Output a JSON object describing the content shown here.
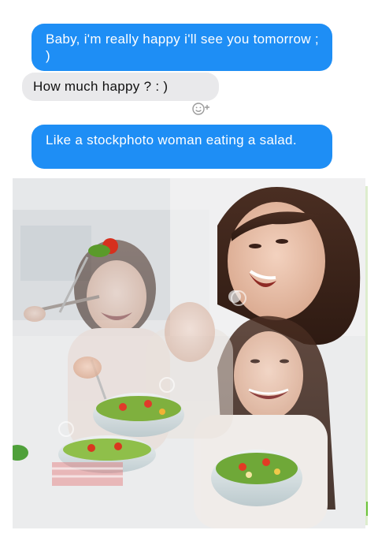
{
  "conversation": {
    "messages": [
      {
        "sender": "me",
        "text": "Baby, i'm really happy i'll see you tomorrow ; )"
      },
      {
        "sender": "them",
        "text": "How much happy ? : )"
      },
      {
        "sender": "me",
        "text": "Like a stockphoto woman eating a salad."
      }
    ],
    "reaction_icon": "add-reaction-icon"
  },
  "photo": {
    "description_icon": "stock-photo-collage-image"
  },
  "colors": {
    "sent_bubble": "#1e8ef5",
    "received_bubble": "#e9e9eb",
    "sent_text": "#ffffff",
    "received_text": "#111111"
  }
}
